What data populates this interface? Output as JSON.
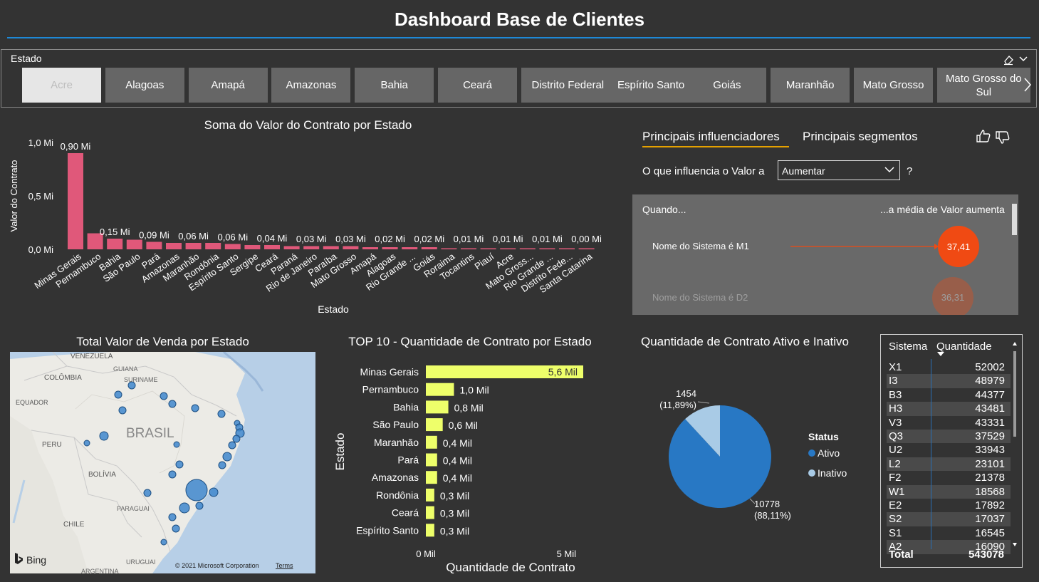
{
  "title": "Dashboard Base de Clientes",
  "slicer": {
    "title": "Estado",
    "items": [
      "Acre",
      "Alagoas",
      "Amapá",
      "Amazonas",
      "Bahia",
      "Ceará",
      "Distrito Federal",
      "Espírito Santo",
      "Goiás",
      "Maranhão",
      "Mato Grosso",
      "Mato Grosso do Sul"
    ],
    "selected": "Acre"
  },
  "chart_data": [
    {
      "type": "bar",
      "title": "Soma do Valor do Contrato por Estado",
      "xlabel": "Estado",
      "ylabel": "Valor do Contrato",
      "yticks": [
        "0,0 Mi",
        "0,5 Mi",
        "1,0 Mi"
      ],
      "ylim": [
        0,
        1.0
      ],
      "color": "#e0587a",
      "categories": [
        "Minas Gerais",
        "Pernambuco",
        "Bahia",
        "São Paulo",
        "Pará",
        "Amazonas",
        "Maranhão",
        "Rondônia",
        "Espírito Santo",
        "Sergipe",
        "Ceará",
        "Paraná",
        "Rio de Janeiro",
        "Paraíba",
        "Mato Grosso",
        "Amapá",
        "Alagoas",
        "Rio Grande ...",
        "Goiás",
        "Roraima",
        "Tocantins",
        "Piauí",
        "Acre",
        "Mato Gross...",
        "Rio Grande ...",
        "Distrito Fede...",
        "Santa Catarina"
      ],
      "values": [
        0.9,
        0.15,
        0.1,
        0.09,
        0.07,
        0.06,
        0.06,
        0.06,
        0.05,
        0.04,
        0.04,
        0.03,
        0.03,
        0.03,
        0.03,
        0.02,
        0.02,
        0.02,
        0.02,
        0.01,
        0.01,
        0.01,
        0.01,
        0.01,
        0.01,
        0.0,
        0.0
      ],
      "data_labels": [
        "0,90 Mi",
        "",
        "0,15 Mi",
        "",
        "0,09 Mi",
        "",
        "0,06 Mi",
        "",
        "0,06 Mi",
        "",
        "0,04 Mi",
        "",
        "0,03 Mi",
        "",
        "0,03 Mi",
        "",
        "0,02 Mi",
        "",
        "0,02 Mi",
        "",
        "0,01 Mi",
        "",
        "0,01 Mi",
        "",
        "0,01 Mi",
        "",
        "0,00 Mi"
      ]
    },
    {
      "type": "bar",
      "orientation": "horizontal",
      "title": "TOP 10 - Quantidade de Contrato por Estado",
      "xlabel": "Quantidade de Contrato",
      "ylabel": "Estado",
      "xticks": [
        "0 Mil",
        "5 Mil"
      ],
      "xlim": [
        0,
        5.6
      ],
      "color": "#eeff6a",
      "categories": [
        "Minas Gerais",
        "Pernambuco",
        "Bahia",
        "São Paulo",
        "Maranhão",
        "Pará",
        "Amazonas",
        "Rondônia",
        "Ceará",
        "Espírito Santo"
      ],
      "values": [
        5.6,
        1.0,
        0.8,
        0.6,
        0.4,
        0.4,
        0.4,
        0.3,
        0.3,
        0.3
      ],
      "data_labels": [
        "5,6 Mil",
        "1,0 Mil",
        "0,8 Mil",
        "0,6 Mil",
        "0,4 Mil",
        "0,4 Mil",
        "0,4 Mil",
        "0,3 Mil",
        "0,3 Mil",
        "0,3 Mil"
      ]
    },
    {
      "type": "pie",
      "title": "Quantidade de Contrato Ativo e Inativo",
      "legend_title": "Status",
      "legend_position": "right",
      "slices": [
        {
          "name": "Ativo",
          "value": 10778,
          "label": "10778",
          "pct": "(88,11%)",
          "color": "#2878c4"
        },
        {
          "name": "Inativo",
          "value": 1454,
          "label": "1454",
          "pct": "(11,89%)",
          "color": "#a9cbe6"
        }
      ]
    },
    {
      "type": "table",
      "columns": [
        "Sistema",
        "Quantidade"
      ],
      "rows": [
        [
          "X1",
          "52002"
        ],
        [
          "I3",
          "48979"
        ],
        [
          "B3",
          "44377"
        ],
        [
          "H3",
          "43481"
        ],
        [
          "V3",
          "43331"
        ],
        [
          "Q3",
          "37529"
        ],
        [
          "U2",
          "33943"
        ],
        [
          "L2",
          "23101"
        ],
        [
          "F2",
          "21378"
        ],
        [
          "W1",
          "18568"
        ],
        [
          "E2",
          "17892"
        ],
        [
          "S2",
          "17037"
        ],
        [
          "S1",
          "16545"
        ],
        [
          "A2",
          "16090"
        ]
      ],
      "total_label": "Total",
      "total_value": "543078"
    }
  ],
  "key_influencers": {
    "tab_active": "Principais influenciadores",
    "tab_other": "Principais segmentos",
    "question": "O que influencia o Valor a",
    "dropdown_value": "Aumentar",
    "help": "?",
    "col_left": "Quando...",
    "col_right": "...a média de Valor aumenta",
    "items": [
      {
        "label": "Nome do Sistema é M1",
        "value": "37,41"
      },
      {
        "label": "Nome do Sistema é D2",
        "value": "36,31"
      }
    ],
    "bubble_color": "#f04a13"
  },
  "map": {
    "title": "Total Valor de Venda por Estado",
    "labels": {
      "venezuela": "VENEZUELA",
      "guiana": "GUIANA",
      "suriname": "SURINAME",
      "colombia": "COLÔMBIA",
      "equador": "EQUADOR",
      "brasil": "BRASIL",
      "peru": "PERU",
      "bolivia": "BOLÍVIA",
      "paraguai": "PARAGUAI",
      "chile": "CHILE",
      "uruguai": "URUGUAI",
      "argentina": "ARGENTINA"
    },
    "bing": "Bing",
    "copyright": "© 2021 Microsoft Corporation",
    "terms": "Terms",
    "bubble_color": "#3f87cc"
  }
}
